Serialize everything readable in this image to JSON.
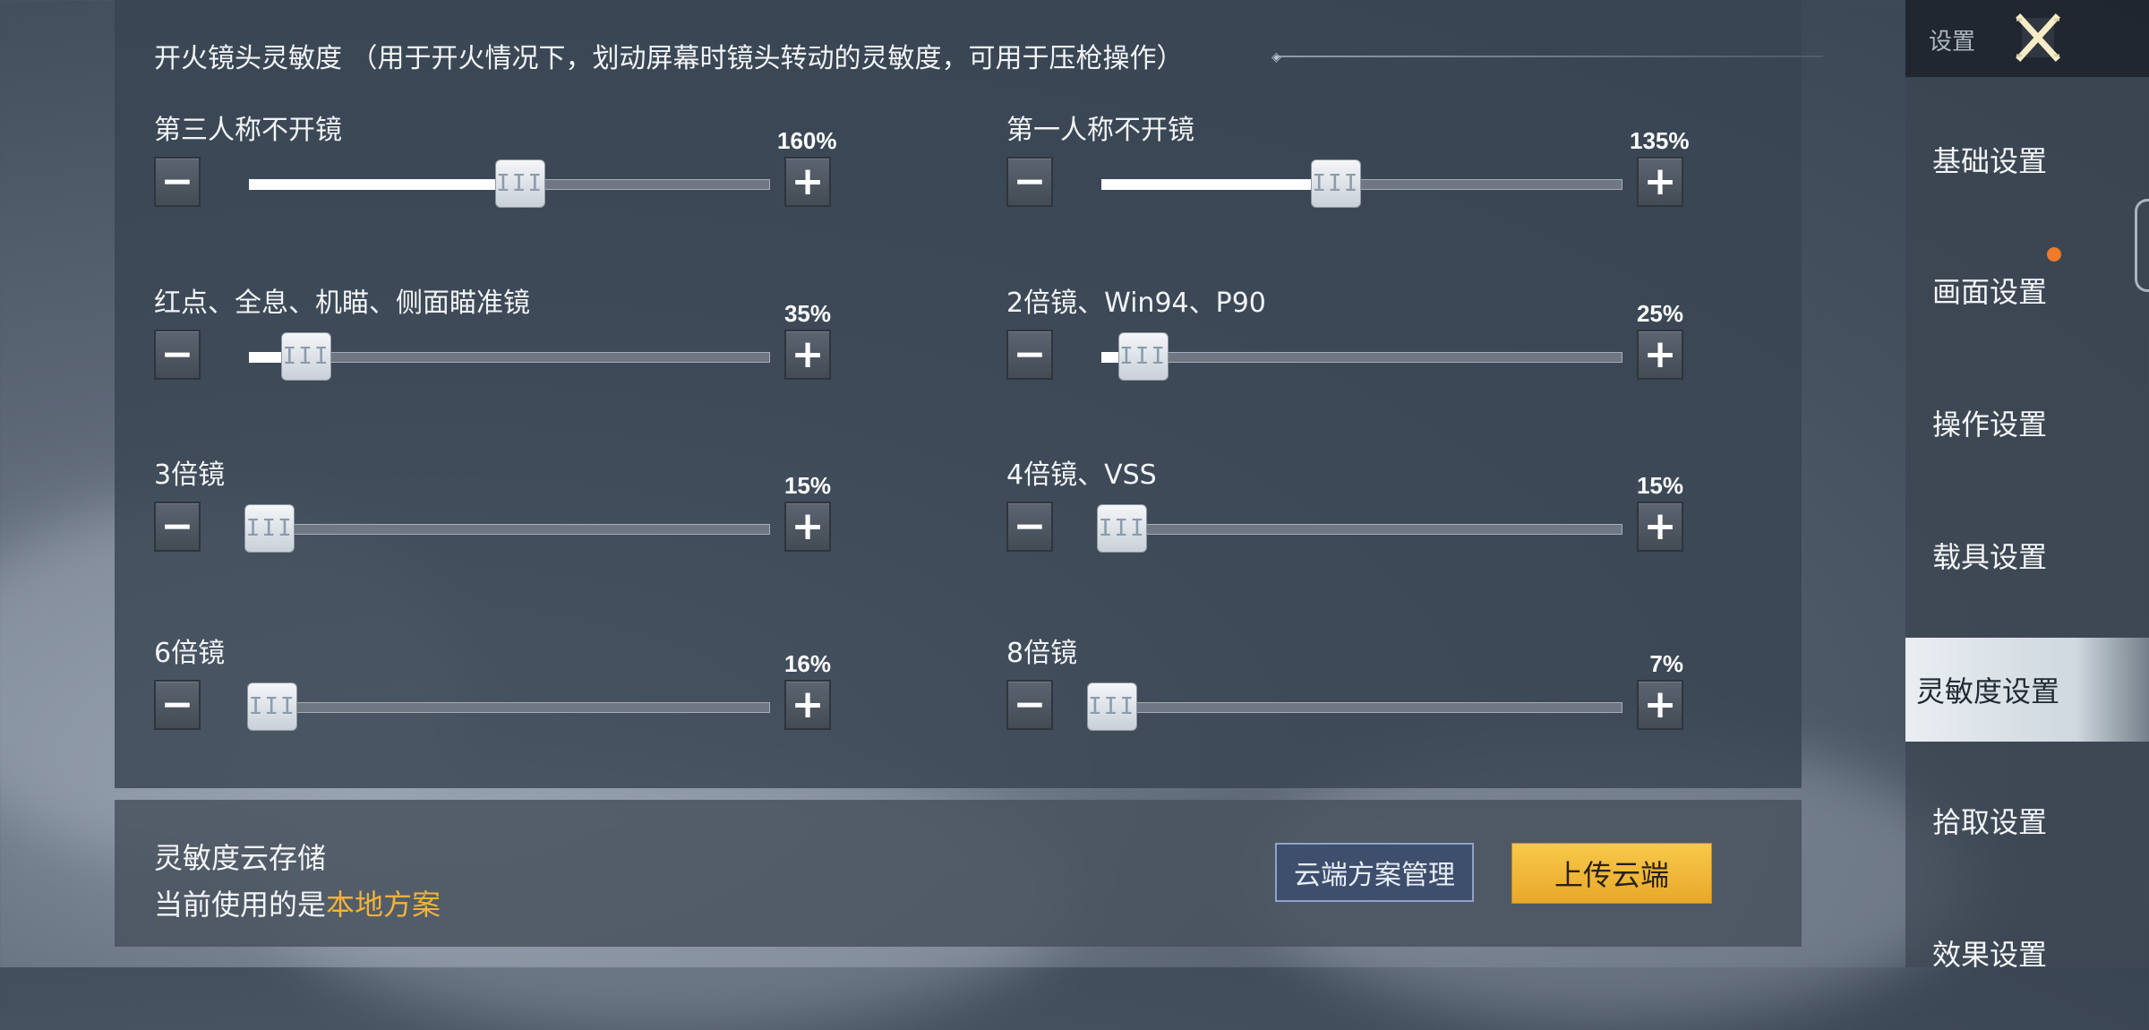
{
  "section": {
    "title": "开火镜头灵敏度 （用于开火情况下，划动屏幕时镜头转动的灵敏度，可用于压枪操作）"
  },
  "sliders": [
    {
      "label": "第三人称不开镜",
      "value_text": "160%",
      "fraction": 0.52
    },
    {
      "label": "第一人称不开镜",
      "value_text": "135%",
      "fraction": 0.45
    },
    {
      "label": "红点、全息、机瞄、侧面瞄准镜",
      "value_text": "35%",
      "fraction": 0.11
    },
    {
      "label": "2倍镜、Win94、P90",
      "value_text": "25%",
      "fraction": 0.08
    },
    {
      "label": "3倍镜",
      "value_text": "15%",
      "fraction": 0.04
    },
    {
      "label": "4倍镜、VSS",
      "value_text": "15%",
      "fraction": 0.04
    },
    {
      "label": "6倍镜",
      "value_text": "16%",
      "fraction": 0.045
    },
    {
      "label": "8倍镜",
      "value_text": "7%",
      "fraction": 0.02
    }
  ],
  "controls": {
    "minus": "−",
    "plus": "+",
    "thumb_grip": "III"
  },
  "cloud": {
    "title": "灵敏度云存储",
    "current_prefix": "当前使用的是",
    "current_plan": "本地方案",
    "manage_label": "云端方案管理",
    "upload_label": "上传云端"
  },
  "sidebar": {
    "header_label": "设置",
    "items": [
      {
        "label": "基础设置",
        "active": false
      },
      {
        "label": "画面设置",
        "active": false
      },
      {
        "label": "操作设置",
        "active": false
      },
      {
        "label": "载具设置",
        "active": false
      },
      {
        "label": "灵敏度设置",
        "active": true
      },
      {
        "label": "拾取设置",
        "active": false
      },
      {
        "label": "效果设置",
        "active": false
      }
    ]
  },
  "colors": {
    "accent_orange": "#f2b23a",
    "badge": "#f07b28",
    "upload_button": "#f8c94a"
  },
  "icons": {
    "close": "close-x-icon",
    "notification": "notification-dot-icon"
  }
}
